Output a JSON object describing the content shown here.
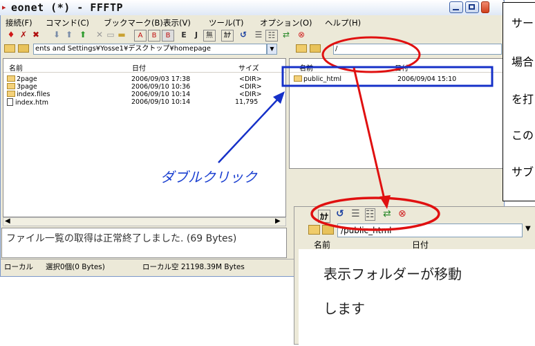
{
  "window": {
    "title": "eonet (*) - FFFTP",
    "controls": [
      "minimize",
      "maximize",
      "close"
    ]
  },
  "menu": {
    "items": [
      "接続(F)",
      "コマンド(C)",
      "ブックマーク(B)",
      "表示(V)",
      "ツール(T)",
      "オプション(O)",
      "ヘルプ(H)"
    ]
  },
  "toolbar": {
    "text_buttons": [
      "E",
      "J",
      "無",
      "ｶﾅ"
    ]
  },
  "local": {
    "path": "ents and Settings¥Yosse1¥デスクトップ¥homepage",
    "columns": [
      "名前",
      "日付",
      "サイズ"
    ],
    "files": [
      {
        "name": "2page",
        "date": "2006/09/03 17:38",
        "size": "<DIR>",
        "type": "folder"
      },
      {
        "name": "3page",
        "date": "2006/09/10 10:36",
        "size": "<DIR>",
        "type": "folder"
      },
      {
        "name": "index.files",
        "date": "2006/09/10 10:14",
        "size": "<DIR>",
        "type": "folder"
      },
      {
        "name": "index.htm",
        "date": "2006/09/10 10:14",
        "size": "11,795",
        "type": "file"
      }
    ]
  },
  "remote": {
    "path": "/",
    "columns": [
      "名前",
      "日付"
    ],
    "files": [
      {
        "name": "public_html",
        "date": "2006/09/04 15:10",
        "type": "folder"
      }
    ]
  },
  "log": {
    "message": "ファイル一覧の取得は正常終了しました. (69 Bytes)"
  },
  "status": {
    "mode": "ローカル",
    "selection": "選択0個(0 Bytes)",
    "free_space": "ローカル空 21198.39M Bytes"
  },
  "annotations": {
    "double_click": "ダブルクリック",
    "note_lines": [
      "サー",
      "場合",
      "を打",
      "この",
      "サブ"
    ]
  },
  "zoom": {
    "path": "/public_html",
    "columns": [
      "名前",
      "日付"
    ],
    "caption_line1": "表示フォルダーが移動",
    "caption_line2": "します"
  },
  "colors": {
    "highlight_red": "#e01010",
    "highlight_blue": "#1530c8",
    "accent_text_blue": "#1a3fd0"
  }
}
